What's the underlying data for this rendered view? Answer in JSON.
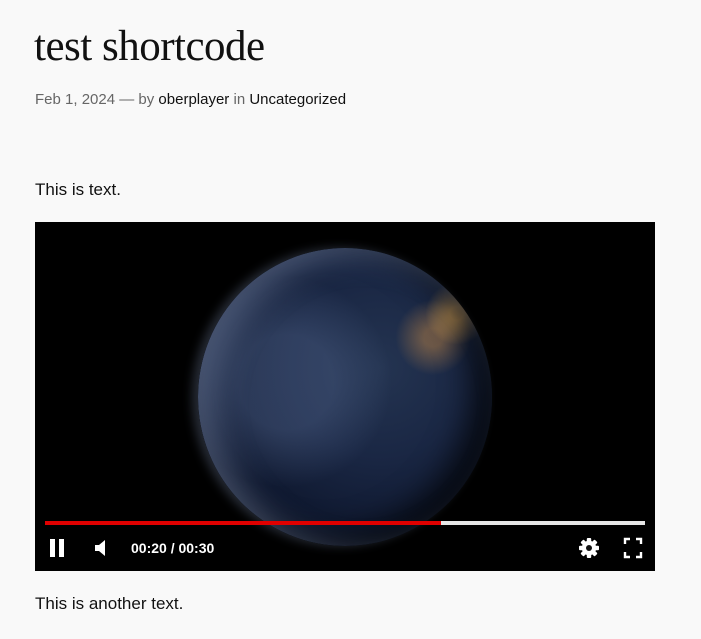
{
  "post": {
    "title": "test shortcode",
    "date": "Feb 1, 2024",
    "separator": "— by",
    "author": "oberplayer",
    "in_label": "in",
    "category": "Uncategorized"
  },
  "content": {
    "paragraph_1": "This is text.",
    "paragraph_2": "This is another text."
  },
  "player": {
    "current_time": "00:20",
    "duration": "00:30",
    "time_display": "00:20 / 00:30",
    "progress_fraction": 0.66,
    "progress_color": "#e00000",
    "track_color": "#e6e6e6",
    "state": "playing",
    "icons": {
      "play_pause": "pause-icon",
      "volume": "volume-icon",
      "settings": "gear-icon",
      "fullscreen": "fullscreen-icon"
    }
  }
}
